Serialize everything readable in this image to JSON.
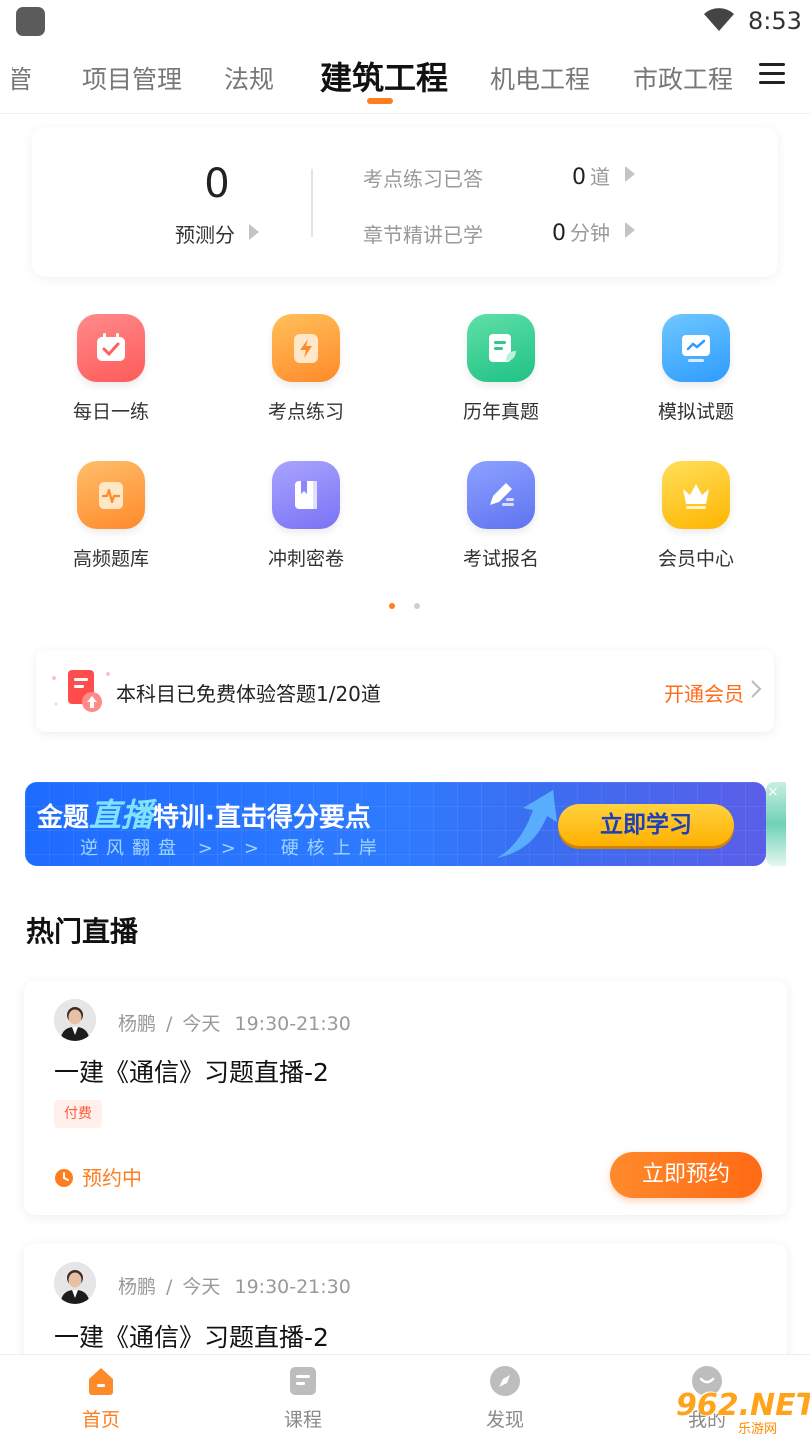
{
  "status_bar": {
    "time": "8:53",
    "icons": [
      "app-icon",
      "wifi-icon"
    ]
  },
  "tabs": [
    {
      "label": "管",
      "active": false
    },
    {
      "label": "项目管理",
      "active": false
    },
    {
      "label": "法规",
      "active": false
    },
    {
      "label": "建筑工程",
      "active": true
    },
    {
      "label": "机电工程",
      "active": false
    },
    {
      "label": "市政工程",
      "active": false
    }
  ],
  "score_card": {
    "score": "0",
    "score_label": "预测分",
    "stats": [
      {
        "label": "考点练习已答",
        "value": "0",
        "unit": "道"
      },
      {
        "label": "章节精讲已学",
        "value": "0",
        "unit": "分钟"
      }
    ]
  },
  "features": [
    {
      "label": "每日一练",
      "icon": "calendar-check-icon",
      "color_from": "#ff8a8a",
      "color_to": "#ff5a5a"
    },
    {
      "label": "考点练习",
      "icon": "lightning-icon",
      "color_from": "#ffc05a",
      "color_to": "#ff8a2a"
    },
    {
      "label": "历年真题",
      "icon": "document-leaf-icon",
      "color_from": "#5fe0a8",
      "color_to": "#1fc184"
    },
    {
      "label": "模拟试题",
      "icon": "monitor-chart-icon",
      "color_from": "#6fc8ff",
      "color_to": "#2f9bff"
    },
    {
      "label": "高频题库",
      "icon": "scroll-pulse-icon",
      "color_from": "#ffbe6a",
      "color_to": "#ff8a2a"
    },
    {
      "label": "冲刺密卷",
      "icon": "book-icon",
      "color_from": "#a9a4ff",
      "color_to": "#7a72f5"
    },
    {
      "label": "考试报名",
      "icon": "pen-icon",
      "color_from": "#8da2ff",
      "color_to": "#5f73f0"
    },
    {
      "label": "会员中心",
      "icon": "crown-icon",
      "color_from": "#ffdf5a",
      "color_to": "#ffb500"
    }
  ],
  "pager": {
    "active": 0,
    "count": 2
  },
  "trial": {
    "text": "本科目已免费体验答题1/20道",
    "link": "开通会员"
  },
  "banner": {
    "title_prefix": "金题",
    "title_highlight": "直播",
    "title_suffix": "特训·直击得分要点",
    "subtitle": "逆风翻盘 >>> 硬核上岸",
    "button": "立即学习",
    "close": "×"
  },
  "section_title": "热门直播",
  "live_cards": [
    {
      "teacher": "杨鹏",
      "date": "今天",
      "time": "19:30-21:30",
      "title": "一建《通信》习题直播-2",
      "badge": "付费",
      "status": "预约中",
      "action": "立即预约"
    },
    {
      "teacher": "杨鹏",
      "date": "今天",
      "time": "19:30-21:30",
      "title": "一建《通信》习题直播-2"
    }
  ],
  "bottom_nav": [
    {
      "label": "首页",
      "icon": "home-icon",
      "active": true
    },
    {
      "label": "课程",
      "icon": "course-icon",
      "active": false
    },
    {
      "label": "发现",
      "icon": "compass-icon",
      "active": false
    },
    {
      "label": "我的",
      "icon": "profile-icon",
      "active": false
    }
  ],
  "watermark": {
    "text": "962.NET",
    "sub": "乐游网"
  },
  "colors": {
    "accent": "#ff7d1f",
    "text": "#222222",
    "muted": "#999999"
  }
}
